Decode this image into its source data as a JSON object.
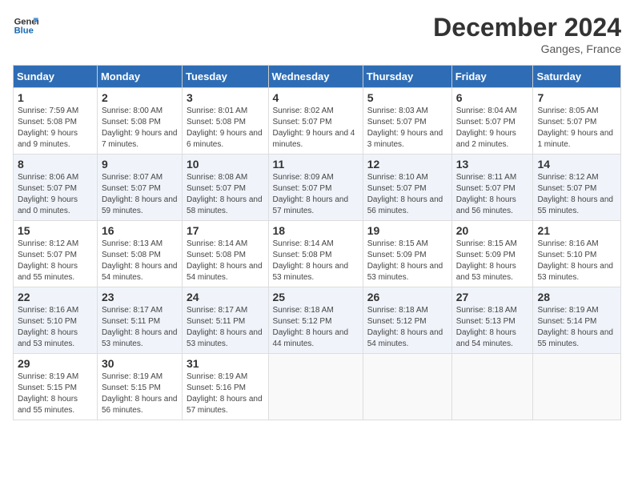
{
  "header": {
    "logo_line1": "General",
    "logo_line2": "Blue",
    "month": "December 2024",
    "location": "Ganges, France"
  },
  "weekdays": [
    "Sunday",
    "Monday",
    "Tuesday",
    "Wednesday",
    "Thursday",
    "Friday",
    "Saturday"
  ],
  "weeks": [
    [
      {
        "day": 1,
        "sunrise": "7:59 AM",
        "sunset": "5:08 PM",
        "daylight": "9 hours and 9 minutes."
      },
      {
        "day": 2,
        "sunrise": "8:00 AM",
        "sunset": "5:08 PM",
        "daylight": "9 hours and 7 minutes."
      },
      {
        "day": 3,
        "sunrise": "8:01 AM",
        "sunset": "5:08 PM",
        "daylight": "9 hours and 6 minutes."
      },
      {
        "day": 4,
        "sunrise": "8:02 AM",
        "sunset": "5:07 PM",
        "daylight": "9 hours and 4 minutes."
      },
      {
        "day": 5,
        "sunrise": "8:03 AM",
        "sunset": "5:07 PM",
        "daylight": "9 hours and 3 minutes."
      },
      {
        "day": 6,
        "sunrise": "8:04 AM",
        "sunset": "5:07 PM",
        "daylight": "9 hours and 2 minutes."
      },
      {
        "day": 7,
        "sunrise": "8:05 AM",
        "sunset": "5:07 PM",
        "daylight": "9 hours and 1 minute."
      }
    ],
    [
      {
        "day": 8,
        "sunrise": "8:06 AM",
        "sunset": "5:07 PM",
        "daylight": "9 hours and 0 minutes."
      },
      {
        "day": 9,
        "sunrise": "8:07 AM",
        "sunset": "5:07 PM",
        "daylight": "8 hours and 59 minutes."
      },
      {
        "day": 10,
        "sunrise": "8:08 AM",
        "sunset": "5:07 PM",
        "daylight": "8 hours and 58 minutes."
      },
      {
        "day": 11,
        "sunrise": "8:09 AM",
        "sunset": "5:07 PM",
        "daylight": "8 hours and 57 minutes."
      },
      {
        "day": 12,
        "sunrise": "8:10 AM",
        "sunset": "5:07 PM",
        "daylight": "8 hours and 56 minutes."
      },
      {
        "day": 13,
        "sunrise": "8:11 AM",
        "sunset": "5:07 PM",
        "daylight": "8 hours and 56 minutes."
      },
      {
        "day": 14,
        "sunrise": "8:12 AM",
        "sunset": "5:07 PM",
        "daylight": "8 hours and 55 minutes."
      }
    ],
    [
      {
        "day": 15,
        "sunrise": "8:12 AM",
        "sunset": "5:07 PM",
        "daylight": "8 hours and 55 minutes."
      },
      {
        "day": 16,
        "sunrise": "8:13 AM",
        "sunset": "5:08 PM",
        "daylight": "8 hours and 54 minutes."
      },
      {
        "day": 17,
        "sunrise": "8:14 AM",
        "sunset": "5:08 PM",
        "daylight": "8 hours and 54 minutes."
      },
      {
        "day": 18,
        "sunrise": "8:14 AM",
        "sunset": "5:08 PM",
        "daylight": "8 hours and 53 minutes."
      },
      {
        "day": 19,
        "sunrise": "8:15 AM",
        "sunset": "5:09 PM",
        "daylight": "8 hours and 53 minutes."
      },
      {
        "day": 20,
        "sunrise": "8:15 AM",
        "sunset": "5:09 PM",
        "daylight": "8 hours and 53 minutes."
      },
      {
        "day": 21,
        "sunrise": "8:16 AM",
        "sunset": "5:10 PM",
        "daylight": "8 hours and 53 minutes."
      }
    ],
    [
      {
        "day": 22,
        "sunrise": "8:16 AM",
        "sunset": "5:10 PM",
        "daylight": "8 hours and 53 minutes."
      },
      {
        "day": 23,
        "sunrise": "8:17 AM",
        "sunset": "5:11 PM",
        "daylight": "8 hours and 53 minutes."
      },
      {
        "day": 24,
        "sunrise": "8:17 AM",
        "sunset": "5:11 PM",
        "daylight": "8 hours and 53 minutes."
      },
      {
        "day": 25,
        "sunrise": "8:18 AM",
        "sunset": "5:12 PM",
        "daylight": "8 hours and 44 minutes."
      },
      {
        "day": 26,
        "sunrise": "8:18 AM",
        "sunset": "5:12 PM",
        "daylight": "8 hours and 54 minutes."
      },
      {
        "day": 27,
        "sunrise": "8:18 AM",
        "sunset": "5:13 PM",
        "daylight": "8 hours and 54 minutes."
      },
      {
        "day": 28,
        "sunrise": "8:19 AM",
        "sunset": "5:14 PM",
        "daylight": "8 hours and 55 minutes."
      }
    ],
    [
      {
        "day": 29,
        "sunrise": "8:19 AM",
        "sunset": "5:15 PM",
        "daylight": "8 hours and 55 minutes."
      },
      {
        "day": 30,
        "sunrise": "8:19 AM",
        "sunset": "5:15 PM",
        "daylight": "8 hours and 56 minutes."
      },
      {
        "day": 31,
        "sunrise": "8:19 AM",
        "sunset": "5:16 PM",
        "daylight": "8 hours and 57 minutes."
      },
      null,
      null,
      null,
      null
    ]
  ]
}
